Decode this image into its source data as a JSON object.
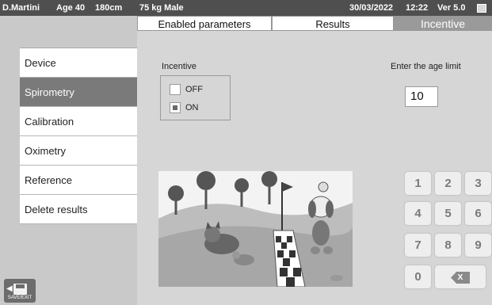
{
  "status_bar": {
    "patient": "D.Martini",
    "age": "Age 40",
    "height": "180cm",
    "weight_sex": "75 kg Male",
    "date": "30/03/2022",
    "time": "12:22",
    "version": "Ver 5.0",
    "battery_icon": "battery-icon"
  },
  "tabs": [
    {
      "label": "Enabled parameters",
      "active": false
    },
    {
      "label": "Results",
      "active": false
    },
    {
      "label": "Incentive",
      "active": true
    }
  ],
  "sidebar": {
    "items": [
      {
        "label": "Device"
      },
      {
        "label": "Spirometry",
        "active": true
      },
      {
        "label": "Calibration"
      },
      {
        "label": "Oximetry"
      },
      {
        "label": "Reference"
      },
      {
        "label": "Delete results"
      }
    ]
  },
  "incentive": {
    "title": "Incentive",
    "options": [
      {
        "label": "OFF",
        "checked": false
      },
      {
        "label": "ON",
        "checked": true
      }
    ]
  },
  "age_limit": {
    "label": "Enter the age limit",
    "value": "10"
  },
  "keypad": {
    "keys": [
      "1",
      "2",
      "3",
      "4",
      "5",
      "6",
      "7",
      "8",
      "9",
      "0"
    ],
    "backspace_icon": "X"
  },
  "save_exit": {
    "label": "SAVE/EXIT",
    "icon": "floppy-disk-icon"
  },
  "colors": {
    "status_bar": "#4f4f4f",
    "active_menu": "#7a7a7a",
    "active_tab": "#9a9a9a",
    "background": "#d6d6d6"
  }
}
